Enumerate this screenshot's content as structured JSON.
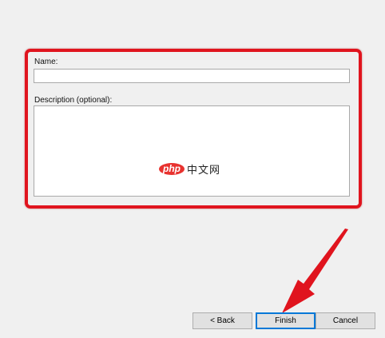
{
  "form": {
    "name_label": "Name:",
    "name_value": "",
    "description_label": "Description (optional):",
    "description_value": ""
  },
  "watermark": {
    "badge": "php",
    "text": "中文网"
  },
  "buttons": {
    "back": "< Back",
    "finish": "Finish",
    "cancel": "Cancel"
  },
  "colors": {
    "highlight": "#e0141e",
    "arrow": "#e0141e",
    "default_button_border": "#0078d7",
    "background": "#f0f0f0"
  },
  "icons": {
    "arrow": "red-pointer-arrow-icon"
  }
}
